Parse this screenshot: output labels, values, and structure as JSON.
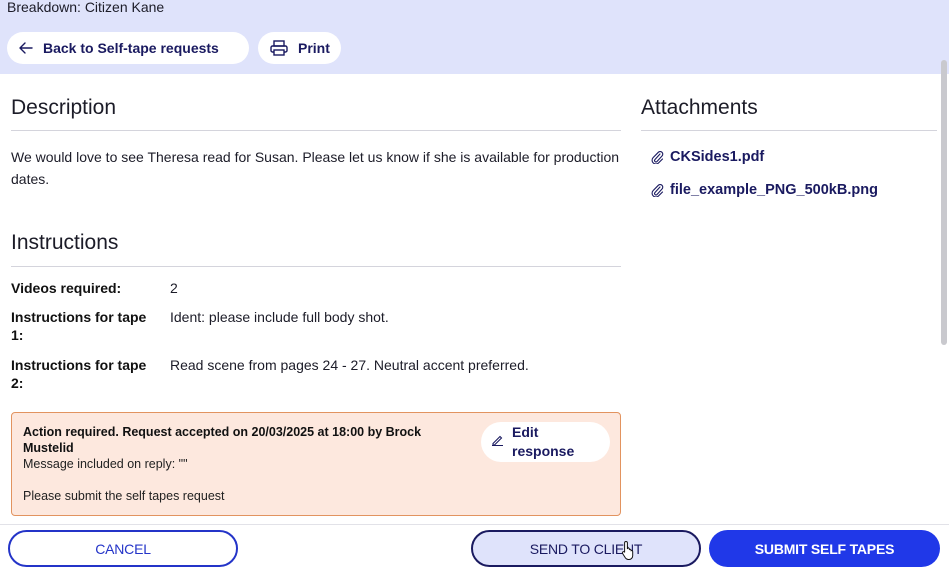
{
  "header": {
    "breadcrumb": "Breakdown: Citizen Kane",
    "back_label": "Back to Self-tape requests",
    "print_label": "Print"
  },
  "description": {
    "title": "Description",
    "text": "We would love to see Theresa read for Susan. Please let us know if she is available for production dates."
  },
  "instructions": {
    "title": "Instructions",
    "rows": [
      {
        "label": "Videos required:",
        "value": "2"
      },
      {
        "label": "Instructions for tape 1:",
        "value": "Ident: please include full body shot."
      },
      {
        "label": "Instructions for tape 2:",
        "value": "Read scene from pages 24 - 27. Neutral accent preferred."
      }
    ]
  },
  "action": {
    "heading": "Action required. Request accepted on 20/03/2025 at 18:00 by Brock Mustelid",
    "message": "Message included on reply: \"\"",
    "note": "Please submit the self tapes request",
    "edit_label": "Edit response"
  },
  "attachments": {
    "title": "Attachments",
    "files": [
      "CKSides1.pdf",
      "file_example_PNG_500kB.png"
    ]
  },
  "footer": {
    "cancel_label": "CANCEL",
    "send_label": "SEND TO CLIENT",
    "submit_label": "SUBMIT SELF TAPES"
  },
  "colors": {
    "header_bg": "#dfe3fb",
    "brand_dark": "#1a1a60",
    "primary": "#2038e8",
    "alert_bg": "#fde8de",
    "alert_border": "#e2935f"
  },
  "icons": [
    "arrow-left-icon",
    "printer-icon",
    "paperclip-icon",
    "pencil-icon",
    "hand-cursor-icon"
  ]
}
